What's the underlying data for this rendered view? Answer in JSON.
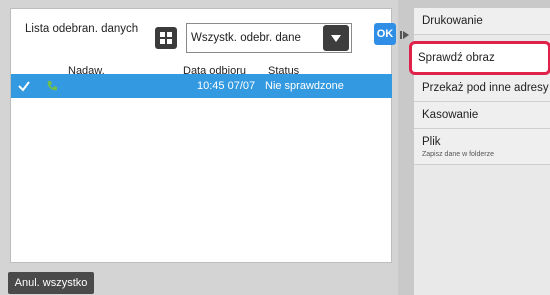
{
  "list": {
    "title": "Lista odebran. danych",
    "filter_value": "Wszystk. odebr. dane",
    "ok_label": "OK",
    "columns": [
      "Nadaw.",
      "Data odbioru",
      "Status"
    ],
    "rows": [
      {
        "sender": "",
        "received": "10:45 07/07",
        "status": "Nie sprawdzone",
        "selected": true,
        "type_icon": "fax-phone-icon"
      }
    ]
  },
  "footer": {
    "cancel_all_label": "Anul. wszystko"
  },
  "menu": {
    "items": [
      {
        "label": "Drukowanie"
      },
      {
        "label": "Sprawdź obraz"
      },
      {
        "label": "Przekaż pod inne adresy"
      },
      {
        "label": "Kasowanie"
      },
      {
        "label": "Plik",
        "sublabel": "Zapisz dane w folderze"
      }
    ]
  },
  "colors": {
    "selection": "#3399e0",
    "highlight": "#e0224b",
    "ok_button": "#2f8fe6"
  }
}
